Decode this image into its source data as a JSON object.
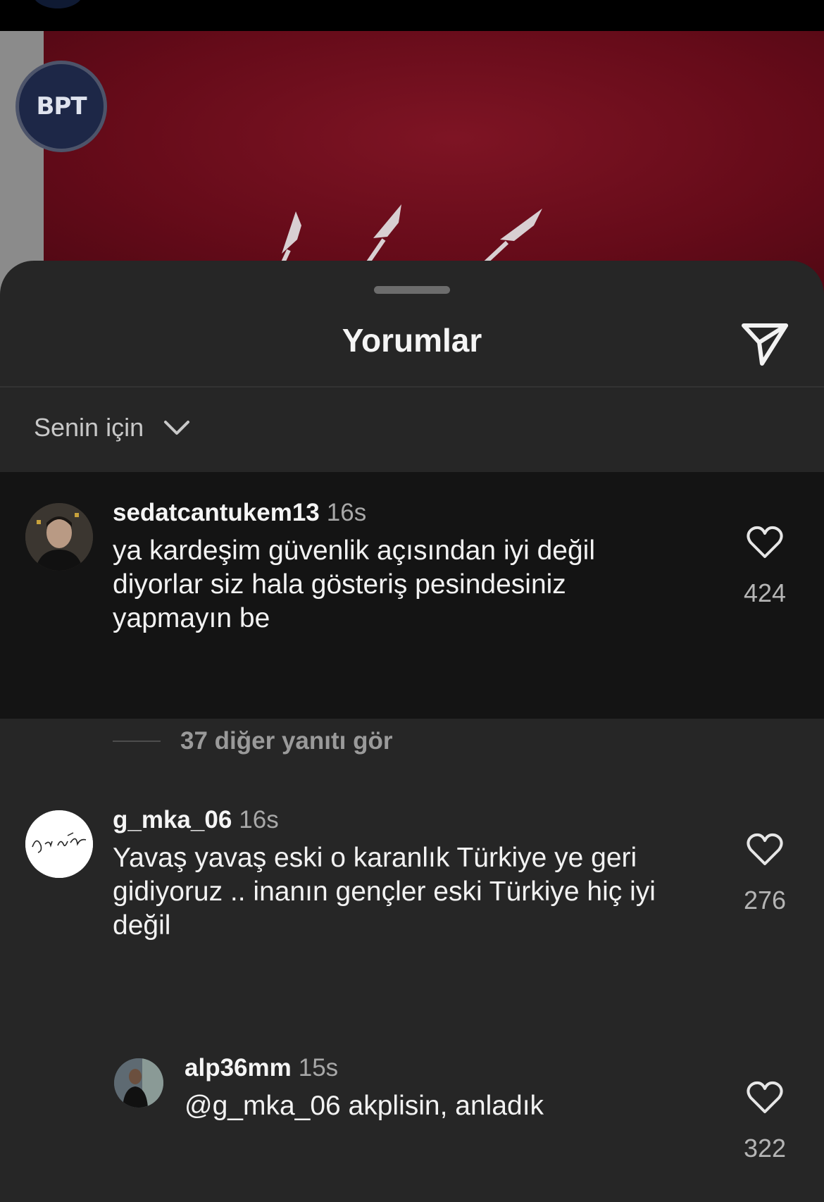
{
  "post": {
    "avatar_text": "BPT"
  },
  "sheet": {
    "title": "Yorumlar"
  },
  "filter": {
    "label": "Senin için"
  },
  "comments": [
    {
      "username": "sedatcantukem13",
      "time": "16s",
      "text": "ya kardeşim güvenlik açısından iyi değil diyorlar siz hala gösteriş pesindesiniz yapmayın be",
      "likes": "424"
    },
    {
      "username": "g_mka_06",
      "time": "16s",
      "text": "Yavaş yavaş eski o karanlık Türkiye ye geri gidiyoruz .. inanın gençler eski Türkiye hiç iyi değil",
      "likes": "276"
    }
  ],
  "more_replies": {
    "label": "37 diğer yanıtı gör"
  },
  "reply": {
    "username": "alp36mm",
    "time": "15s",
    "text": "@g_mka_06 akplisin, anladık",
    "likes": "322"
  },
  "colors": {
    "sheet_bg": "#262626",
    "highlight_bg": "#141414",
    "post_bg": "#6f0d1b"
  }
}
